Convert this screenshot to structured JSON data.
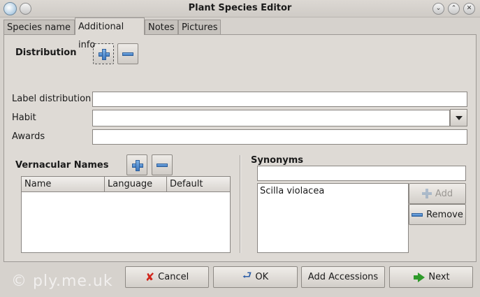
{
  "window": {
    "title": "Plant Species Editor",
    "controls": [
      "minimize-icon",
      "maximize-icon",
      "close-icon"
    ]
  },
  "tabs": [
    {
      "label": "Species name",
      "active": false
    },
    {
      "label": "Additional info",
      "active": true
    },
    {
      "label": "Notes",
      "active": false
    },
    {
      "label": "Pictures",
      "active": false
    }
  ],
  "distribution": {
    "label": "Distribution",
    "add_icon": "plus-icon",
    "remove_icon": "minus-icon"
  },
  "fields": {
    "label_distribution": {
      "label": "Label distribution",
      "value": ""
    },
    "habit": {
      "label": "Habit",
      "value": ""
    },
    "awards": {
      "label": "Awards",
      "value": ""
    }
  },
  "vernacular": {
    "label": "Vernacular Names",
    "columns": [
      "Name",
      "Language",
      "Default"
    ],
    "rows": []
  },
  "synonyms": {
    "label": "Synonyms",
    "search_value": "",
    "items": [
      "Scilla violacea"
    ],
    "add_label": "Add",
    "remove_label": "Remove"
  },
  "buttons": {
    "cancel": "Cancel",
    "ok": "OK",
    "add_accessions": "Add Accessions",
    "next": "Next"
  },
  "watermark": "© ply.me.uk",
  "colors": {
    "background": "#d6d2cd",
    "accent_blue": "#3c78c0",
    "cancel_red": "#d0261c",
    "next_green": "#2e9a2a"
  }
}
